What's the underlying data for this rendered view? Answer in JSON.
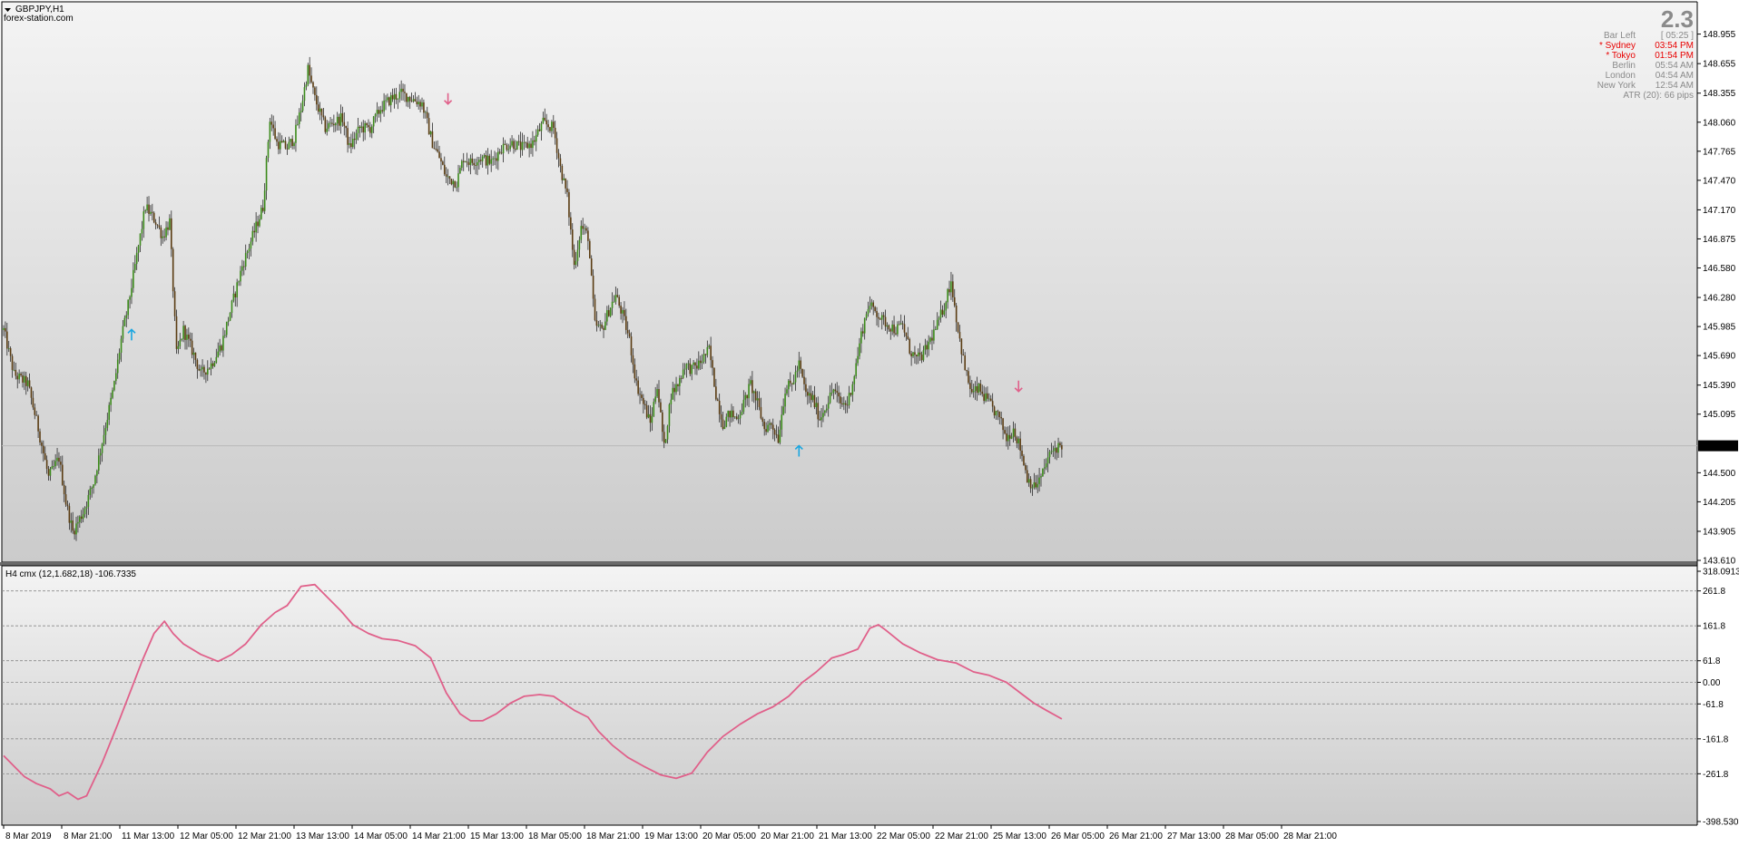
{
  "window": {
    "symbol_title": "GBPJPY,H1",
    "watermark_text": "forex-station.com",
    "dropdown_icon": "triangle-down-icon"
  },
  "info_panel": {
    "big_value": "2.3",
    "rows": [
      {
        "label": "Bar Left",
        "value": "[ 05:25 ]",
        "color": "#8a8a8a"
      },
      {
        "label": "* Sydney",
        "value": "03:54 PM",
        "color": "#e80000"
      },
      {
        "label": "* Tokyo",
        "value": "01:54 PM",
        "color": "#e80000"
      },
      {
        "label": "Berlin",
        "value": "05:54 AM",
        "color": "#8a8a8a"
      },
      {
        "label": "London",
        "value": "04:54 AM",
        "color": "#8a8a8a"
      },
      {
        "label": "New York",
        "value": "12:54 AM",
        "color": "#8a8a8a"
      }
    ],
    "atr_text": "ATR (20): 66 pips"
  },
  "indicator": {
    "label": "H4 cmx (12,1.682,18) -106.7335"
  },
  "colors": {
    "bull": "#3b8a1a",
    "bear": "#5a3c12",
    "wick": "#2b2b2b",
    "indicator_line": "#e0608a",
    "arrow_up": "#19a6e0",
    "arrow_down": "#e0608a",
    "price_tag_bg": "#000000",
    "price_tag_fg": "#ffffff",
    "grid_dash": "#8a8a8a"
  },
  "chart_data": [
    {
      "type": "candlestick",
      "symbol": "GBPJPY",
      "timeframe": "H1",
      "ylim": [
        143.61,
        149.255
      ],
      "yticks": [
        "148.955",
        "148.655",
        "148.355",
        "148.060",
        "147.765",
        "147.470",
        "147.170",
        "146.875",
        "146.580",
        "146.280",
        "145.985",
        "145.690",
        "145.390",
        "145.095",
        "144.500",
        "144.205",
        "143.905",
        "143.610"
      ],
      "current_price": "144.774",
      "xticks": [
        "8 Mar 2019",
        "8 Mar 21:00",
        "11 Mar 13:00",
        "12 Mar 05:00",
        "12 Mar 21:00",
        "13 Mar 13:00",
        "14 Mar 05:00",
        "14 Mar 21:00",
        "15 Mar 13:00",
        "18 Mar 05:00",
        "18 Mar 21:00",
        "19 Mar 13:00",
        "20 Mar 05:00",
        "20 Mar 21:00",
        "21 Mar 13:00",
        "22 Mar 05:00",
        "22 Mar 21:00",
        "25 Mar 13:00",
        "26 Mar 05:00",
        "26 Mar 21:00",
        "27 Mar 13:00",
        "28 Mar 05:00",
        "28 Mar 21:00"
      ],
      "close_path": [
        [
          0,
          145.95
        ],
        [
          6,
          145.5
        ],
        [
          14,
          145.4
        ],
        [
          20,
          144.95
        ],
        [
          26,
          144.45
        ],
        [
          32,
          144.65
        ],
        [
          36,
          144.2
        ],
        [
          40,
          143.9
        ],
        [
          46,
          144.1
        ],
        [
          52,
          144.4
        ],
        [
          58,
          144.9
        ],
        [
          64,
          145.4
        ],
        [
          68,
          145.85
        ],
        [
          72,
          146.2
        ],
        [
          76,
          146.6
        ],
        [
          82,
          147.2
        ],
        [
          88,
          147.05
        ],
        [
          92,
          146.9
        ],
        [
          96,
          147.05
        ],
        [
          100,
          145.7
        ],
        [
          104,
          145.95
        ],
        [
          110,
          145.7
        ],
        [
          114,
          145.5
        ],
        [
          120,
          145.6
        ],
        [
          126,
          145.8
        ],
        [
          132,
          146.2
        ],
        [
          138,
          146.6
        ],
        [
          144,
          146.9
        ],
        [
          150,
          147.2
        ],
        [
          154,
          148.1
        ],
        [
          158,
          147.85
        ],
        [
          164,
          147.8
        ],
        [
          168,
          147.9
        ],
        [
          172,
          148.2
        ],
        [
          176,
          148.6
        ],
        [
          180,
          148.3
        ],
        [
          186,
          148.0
        ],
        [
          190,
          148.05
        ],
        [
          196,
          148.1
        ],
        [
          200,
          147.8
        ],
        [
          206,
          148.0
        ],
        [
          212,
          148.0
        ],
        [
          218,
          148.2
        ],
        [
          224,
          148.3
        ],
        [
          230,
          148.35
        ],
        [
          236,
          148.3
        ],
        [
          242,
          148.25
        ],
        [
          248,
          147.85
        ],
        [
          252,
          147.7
        ],
        [
          256,
          147.5
        ],
        [
          262,
          147.45
        ],
        [
          266,
          147.7
        ],
        [
          270,
          147.65
        ],
        [
          276,
          147.7
        ],
        [
          282,
          147.65
        ],
        [
          288,
          147.8
        ],
        [
          294,
          147.85
        ],
        [
          300,
          147.8
        ],
        [
          306,
          147.85
        ],
        [
          312,
          148.05
        ],
        [
          318,
          148.0
        ],
        [
          322,
          147.6
        ],
        [
          326,
          147.3
        ],
        [
          330,
          146.6
        ],
        [
          334,
          147.0
        ],
        [
          338,
          146.9
        ],
        [
          342,
          146.0
        ],
        [
          346,
          145.95
        ],
        [
          350,
          146.15
        ],
        [
          354,
          146.3
        ],
        [
          358,
          146.1
        ],
        [
          362,
          145.85
        ],
        [
          366,
          145.4
        ],
        [
          370,
          145.2
        ],
        [
          374,
          145.0
        ],
        [
          378,
          145.4
        ],
        [
          382,
          144.75
        ],
        [
          386,
          145.3
        ],
        [
          390,
          145.4
        ],
        [
          394,
          145.6
        ],
        [
          398,
          145.55
        ],
        [
          402,
          145.6
        ],
        [
          408,
          145.75
        ],
        [
          412,
          145.3
        ],
        [
          416,
          145.0
        ],
        [
          420,
          145.1
        ],
        [
          424,
          145.05
        ],
        [
          428,
          145.2
        ],
        [
          432,
          145.4
        ],
        [
          436,
          145.2
        ],
        [
          440,
          144.95
        ],
        [
          444,
          145.0
        ],
        [
          448,
          144.85
        ],
        [
          452,
          145.35
        ],
        [
          456,
          145.4
        ],
        [
          460,
          145.6
        ],
        [
          464,
          145.3
        ],
        [
          468,
          145.25
        ],
        [
          472,
          145.05
        ],
        [
          476,
          145.2
        ],
        [
          480,
          145.35
        ],
        [
          484,
          145.2
        ],
        [
          488,
          145.2
        ],
        [
          492,
          145.5
        ],
        [
          496,
          145.9
        ],
        [
          500,
          146.2
        ],
        [
          504,
          146.15
        ],
        [
          508,
          146.05
        ],
        [
          512,
          146.0
        ],
        [
          516,
          145.95
        ],
        [
          520,
          146.0
        ],
        [
          524,
          145.75
        ],
        [
          528,
          145.65
        ],
        [
          532,
          145.7
        ],
        [
          536,
          145.85
        ],
        [
          540,
          146.0
        ],
        [
          544,
          146.2
        ],
        [
          548,
          146.45
        ],
        [
          552,
          145.95
        ],
        [
          556,
          145.55
        ],
        [
          560,
          145.3
        ],
        [
          564,
          145.35
        ],
        [
          568,
          145.25
        ],
        [
          572,
          145.15
        ],
        [
          576,
          145.05
        ],
        [
          580,
          144.85
        ],
        [
          584,
          144.95
        ],
        [
          588,
          144.75
        ],
        [
          592,
          144.45
        ],
        [
          596,
          144.35
        ],
        [
          600,
          144.45
        ],
        [
          604,
          144.65
        ],
        [
          608,
          144.75
        ],
        [
          612,
          144.78
        ]
      ],
      "signals": [
        {
          "type": "up",
          "i": 74,
          "price": 145.9
        },
        {
          "type": "down",
          "i": 257,
          "price": 148.3
        },
        {
          "type": "up",
          "i": 460,
          "price": 144.72
        },
        {
          "type": "down",
          "i": 587,
          "price": 145.38
        }
      ]
    },
    {
      "type": "line",
      "name": "H4 cmx (12,1.682,18)",
      "ylim": [
        -398.5301,
        318.0913
      ],
      "yticks": [
        "318.0913",
        "261.8",
        "161.8",
        "61.8",
        "0.00",
        "-61.8",
        "-161.8",
        "-261.8",
        "-398.5301"
      ],
      "levels": [
        261.8,
        161.8,
        61.8,
        0,
        -61.8,
        -161.8,
        -261.8
      ],
      "x": [
        0,
        7,
        12,
        19,
        27,
        32,
        37,
        43,
        48,
        57,
        66,
        73,
        80,
        87,
        93,
        98,
        104,
        114,
        124,
        132,
        140,
        149,
        157,
        164,
        172,
        180,
        188,
        195,
        202,
        211,
        219,
        228,
        238,
        247,
        256,
        264,
        270,
        277,
        285,
        293,
        301,
        310,
        318,
        330,
        338,
        344,
        352,
        361,
        370,
        380,
        389,
        398,
        407,
        416,
        426,
        436,
        445,
        454,
        462,
        470,
        479,
        486,
        494,
        501,
        506,
        510,
        520,
        530,
        540,
        551,
        561,
        570,
        580,
        588,
        596,
        603,
        612
      ],
      "y": [
        -210,
        -245,
        -270,
        -290,
        -305,
        -325,
        -315,
        -335,
        -325,
        -230,
        -120,
        -30,
        60,
        140,
        175,
        140,
        110,
        80,
        60,
        80,
        110,
        165,
        200,
        220,
        275,
        280,
        240,
        205,
        165,
        140,
        125,
        120,
        105,
        70,
        -30,
        -90,
        -110,
        -110,
        -90,
        -60,
        -40,
        -35,
        -40,
        -80,
        -100,
        -140,
        -180,
        -215,
        -240,
        -265,
        -275,
        -260,
        -200,
        -155,
        -120,
        -90,
        -70,
        -40,
        0,
        30,
        70,
        80,
        95,
        155,
        165,
        150,
        110,
        85,
        65,
        55,
        30,
        20,
        0,
        -30,
        -60,
        -80,
        -105
      ]
    }
  ]
}
